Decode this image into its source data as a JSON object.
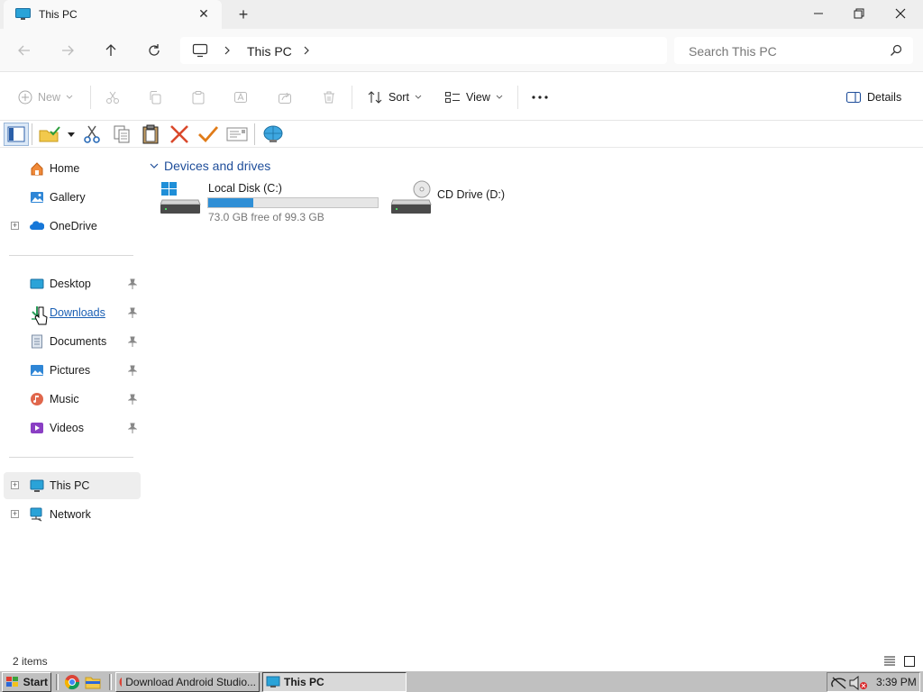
{
  "window": {
    "tab_title": "This PC",
    "new_tab_symbol": "+",
    "close_tab_symbol": "✕"
  },
  "address": {
    "location": "This PC",
    "search_placeholder": "Search This PC"
  },
  "commands": {
    "new_label": "New",
    "sort_label": "Sort",
    "view_label": "View",
    "details_label": "Details"
  },
  "sidebar": {
    "items": [
      {
        "label": "Home",
        "icon": "home-icon"
      },
      {
        "label": "Gallery",
        "icon": "gallery-icon"
      },
      {
        "label": "OneDrive",
        "icon": "onedrive-icon"
      },
      {
        "label": "Desktop",
        "icon": "desktop-icon"
      },
      {
        "label": "Downloads",
        "icon": "downloads-icon"
      },
      {
        "label": "Documents",
        "icon": "documents-icon"
      },
      {
        "label": "Pictures",
        "icon": "pictures-icon"
      },
      {
        "label": "Music",
        "icon": "music-icon"
      },
      {
        "label": "Videos",
        "icon": "videos-icon"
      },
      {
        "label": "This PC",
        "icon": "this-pc-icon",
        "selected": true
      },
      {
        "label": "Network",
        "icon": "network-icon"
      }
    ]
  },
  "content": {
    "group_title": "Devices and drives",
    "drives": [
      {
        "name": "Local Disk (C:)",
        "free_text": "73.0 GB free of 99.3 GB",
        "used_fraction": 0.265,
        "icon": "windows-drive-icon"
      },
      {
        "name": "CD Drive (D:)",
        "icon": "cd-drive-icon"
      }
    ]
  },
  "status": {
    "item_count": "2 items"
  },
  "taskbar": {
    "start_label": "Start",
    "tasks": [
      {
        "label": "Download Android Studio...",
        "icon": "chrome-icon"
      },
      {
        "label": "This PC",
        "icon": "this-pc-icon",
        "active": true
      }
    ],
    "clock": "3:39 PM"
  },
  "colors": {
    "accent": "#1f4e9a",
    "drive_bar_fill": "#2f8fd6",
    "link": "#1a5fb4",
    "taskbar": "#c0c0c0"
  }
}
